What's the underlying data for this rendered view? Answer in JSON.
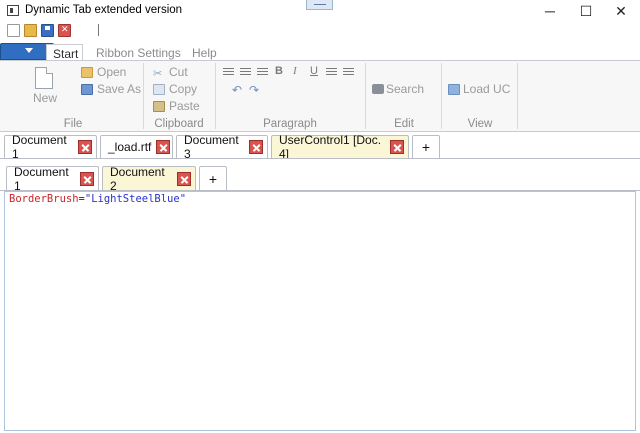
{
  "window": {
    "title": "Dynamic Tab extended version",
    "minimize_glyph": "─",
    "maximize_glyph": "☐",
    "close_glyph": "✕"
  },
  "ribbon": {
    "tabs": [
      "Start",
      "Ribbon Settings",
      "Help"
    ],
    "groups": {
      "file": {
        "label": "File",
        "new": "New",
        "open": "Open",
        "save_as": "Save As"
      },
      "clipboard": {
        "label": "Clipboard",
        "cut": "Cut",
        "copy": "Copy",
        "paste": "Paste"
      },
      "paragraph": {
        "label": "Paragraph",
        "bold": "B",
        "italic": "I",
        "underline": "U"
      },
      "edit": {
        "label": "Edit",
        "search": "Search"
      },
      "view": {
        "label": "View",
        "load_uc": "Load UC"
      }
    }
  },
  "outer_tabs": {
    "items": [
      {
        "label": "Document 1"
      },
      {
        "label": "_load.rtf"
      },
      {
        "label": "Document 3"
      },
      {
        "label": "UserControl1 [Doc. 4]"
      }
    ],
    "active": "UserControl1 [Doc. 4]",
    "add_label": "+"
  },
  "inner_tabs": {
    "items": [
      {
        "label": "Document 1"
      },
      {
        "label": "Document 2"
      }
    ],
    "active": "Document 2",
    "add_label": "+"
  },
  "editor": {
    "attribute": "BorderBrush",
    "equals": "=",
    "value": "\"LightSteelBlue\""
  },
  "colors": {
    "accent": "#2f6ec0",
    "active_tab": "#fbf6d6",
    "close_button": "#d9534f",
    "editor_border": "#b0c4de"
  }
}
